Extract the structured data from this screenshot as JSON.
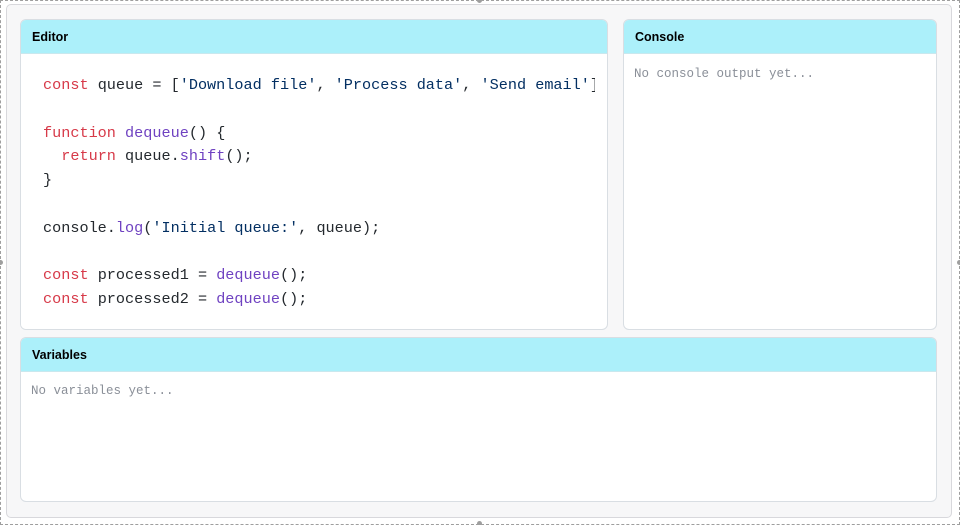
{
  "panels": {
    "editor": {
      "title": "Editor",
      "code_lines": [
        [
          {
            "t": "const",
            "c": "kw"
          },
          {
            "t": " queue = [",
            "c": "plain"
          },
          {
            "t": "'Download file'",
            "c": "str"
          },
          {
            "t": ", ",
            "c": "plain"
          },
          {
            "t": "'Process data'",
            "c": "str"
          },
          {
            "t": ", ",
            "c": "plain"
          },
          {
            "t": "'Send email'",
            "c": "str"
          },
          {
            "t": "];",
            "c": "plain"
          }
        ],
        [],
        [
          {
            "t": "function",
            "c": "kw"
          },
          {
            "t": " ",
            "c": "plain"
          },
          {
            "t": "dequeue",
            "c": "fn"
          },
          {
            "t": "() {",
            "c": "plain"
          }
        ],
        [
          {
            "t": "  ",
            "c": "plain"
          },
          {
            "t": "return",
            "c": "kw"
          },
          {
            "t": " queue.",
            "c": "plain"
          },
          {
            "t": "shift",
            "c": "fn"
          },
          {
            "t": "();",
            "c": "plain"
          }
        ],
        [
          {
            "t": "}",
            "c": "plain"
          }
        ],
        [],
        [
          {
            "t": "console.",
            "c": "plain"
          },
          {
            "t": "log",
            "c": "fn"
          },
          {
            "t": "(",
            "c": "plain"
          },
          {
            "t": "'Initial queue:'",
            "c": "str"
          },
          {
            "t": ", queue);",
            "c": "plain"
          }
        ],
        [],
        [
          {
            "t": "const",
            "c": "kw"
          },
          {
            "t": " processed1 = ",
            "c": "plain"
          },
          {
            "t": "dequeue",
            "c": "fn"
          },
          {
            "t": "();",
            "c": "plain"
          }
        ],
        [
          {
            "t": "const",
            "c": "kw"
          },
          {
            "t": " processed2 = ",
            "c": "plain"
          },
          {
            "t": "dequeue",
            "c": "fn"
          },
          {
            "t": "();",
            "c": "plain"
          }
        ]
      ]
    },
    "console": {
      "title": "Console",
      "placeholder": "No console output yet..."
    },
    "variables": {
      "title": "Variables",
      "placeholder": "No variables yet..."
    }
  },
  "colors": {
    "header_bg": "#acf0fa",
    "keyword": "#d73a49",
    "function": "#6f42c1",
    "string": "#032f62",
    "placeholder": "#8a8f98"
  }
}
